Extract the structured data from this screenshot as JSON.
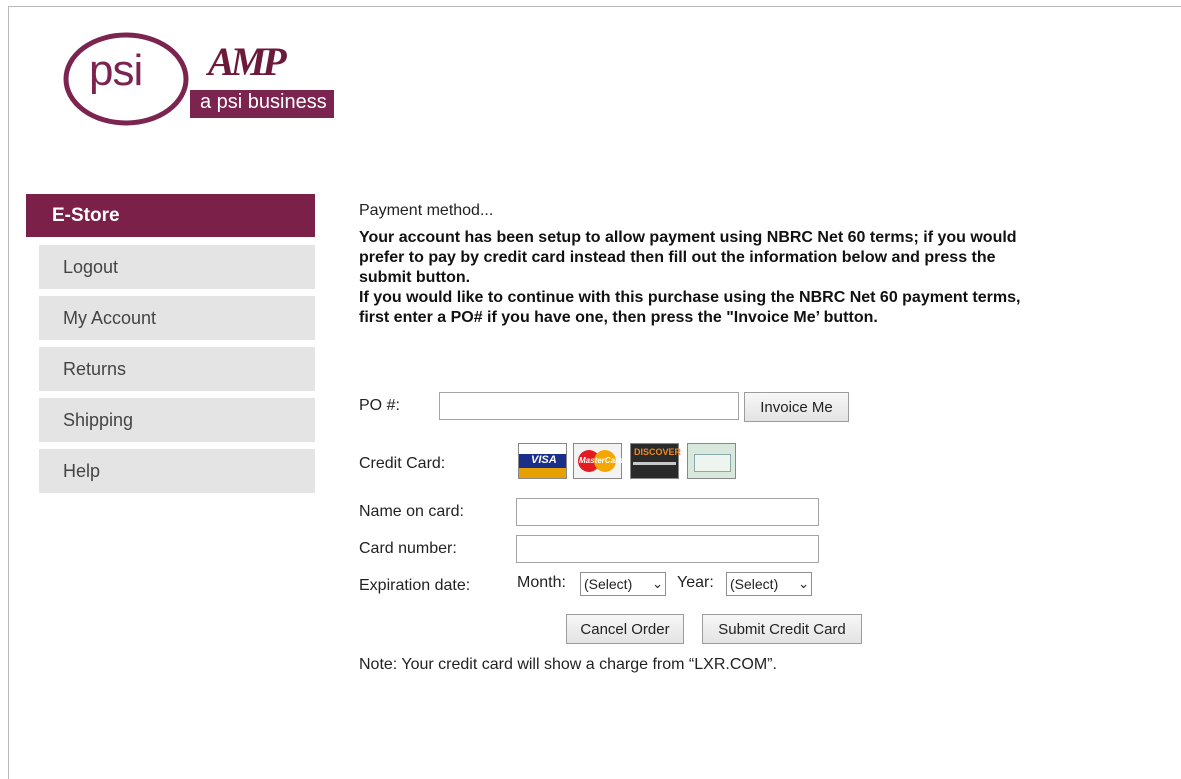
{
  "brand": {
    "psi_word": "psi",
    "amp_word": "AMP",
    "tagline": "a psi business",
    "accent_color": "#7a2049"
  },
  "sidebar": {
    "header": "E-Store",
    "items": [
      {
        "label": "Logout"
      },
      {
        "label": "My Account"
      },
      {
        "label": "Returns"
      },
      {
        "label": "Shipping"
      },
      {
        "label": "Help"
      }
    ]
  },
  "main": {
    "heading": "Payment method...",
    "intro_line1": "Your account has been setup to allow payment using NBRC Net 60 terms; if you would prefer to pay by credit card instead then fill out the information below and press the submit button.",
    "intro_line2": "If you would like to continue with this purchase using the NBRC Net 60 payment terms, first enter a PO# if you have one, then press the \"Invoice Me’ button.",
    "po_label": "PO #:",
    "po_value": "",
    "invoice_button": "Invoice Me",
    "credit_card_label": "Credit Card:",
    "card_icons": [
      {
        "name": "visa-card-icon",
        "text": "VISA"
      },
      {
        "name": "mastercard-icon",
        "text": "MasterCard"
      },
      {
        "name": "discover-card-icon",
        "text": "DISCOVER"
      },
      {
        "name": "amex-card-icon",
        "text": ""
      }
    ],
    "name_label": "Name on card:",
    "name_value": "",
    "number_label": "Card number:",
    "number_value": "",
    "expiration_label": "Expiration date:",
    "month_label": "Month:",
    "month_selected": "(Select)",
    "year_label": "Year:",
    "year_selected": "(Select)",
    "cancel_button": "Cancel Order",
    "submit_button": "Submit Credit Card",
    "note": "Note: Your credit card will show a charge from “LXR.COM”."
  }
}
